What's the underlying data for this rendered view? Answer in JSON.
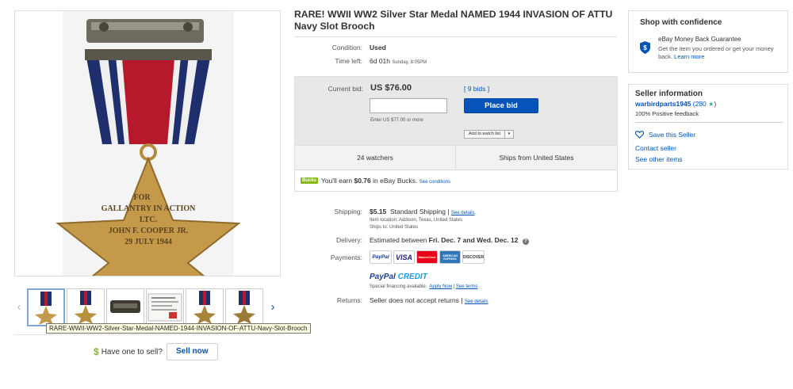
{
  "gallery": {
    "tooltip": "RARE-WWII-WW2-Silver-Star-Medal-NAMED-1944-INVASION-OF-ATTU-Navy-Slot-Brooch",
    "prev_arrow": "‹",
    "next_arrow": "›",
    "medal_text": {
      "line1": "FOR",
      "line2": "GALLANTRY IN ACTION",
      "line3": "LTC.",
      "line4": "JOHN F. COOPER JR.",
      "line5": "29 JULY 1944"
    }
  },
  "sell": {
    "icon": "$",
    "question": "Have one to sell?",
    "button": "Sell now"
  },
  "item": {
    "title": "RARE! WWII WW2 Silver Star Medal NAMED 1944 INVASION OF ATTU Navy Slot Brooch",
    "condition_label": "Condition:",
    "condition_value": "Used",
    "time_left_label": "Time left:",
    "time_left_value": "6d 01h",
    "time_left_detail": "Sunday, 8:05PM"
  },
  "bid": {
    "label": "Current bid:",
    "price": "US $76.00",
    "bids_link": "[ 9 bids ]",
    "input_placeholder": "",
    "hint": "Enter US $77.00 or more",
    "place_bid": "Place bid",
    "watch": "Add to watch list",
    "watch_dropdown": "▾",
    "watchers": "24 watchers",
    "ships_from": "Ships from United States"
  },
  "bucks": {
    "logo": "Bucks",
    "text_pre": "You'll earn ",
    "amount": "$0.76",
    "text_post": " in eBay Bucks.",
    "conditions": "See conditions"
  },
  "shipping": {
    "label": "Shipping:",
    "price": "$5.15",
    "method": "Standard Shipping |",
    "details": "See details",
    "location_line": "Item location:  Addison, Texas, United States",
    "ships_to": "Ships to:  United States"
  },
  "delivery": {
    "label": "Delivery:",
    "prefix": "Estimated between ",
    "range": "Fri. Dec. 7 and Wed. Dec. 12",
    "help_icon": "?"
  },
  "payments": {
    "label": "Payments:",
    "logos": [
      "PayPal",
      "VISA",
      "MasterCard",
      "AMERICAN EXPRESS",
      "DISCOVER"
    ],
    "paypal_credit_a": "PayPal",
    "paypal_credit_b": " CREDIT",
    "financing": "Special financing available.",
    "apply_now": "Apply Now",
    "separator": "|",
    "see_terms": "See terms"
  },
  "returns": {
    "label": "Returns:",
    "value": "Seller does not accept returns |",
    "details": "See details"
  },
  "confidence": {
    "title": "Shop with confidence",
    "heading": "eBay Money Back Guarantee",
    "desc": "Get the item you ordered or get your money back.",
    "learn_more": "Learn more"
  },
  "seller": {
    "title": "Seller information",
    "name": "warbirdparts1945",
    "score": " (280",
    "star": "★",
    "close": ")",
    "feedback": "100% Positive feedback",
    "save": "Save this Seller",
    "contact": "Contact seller",
    "other": "See other items"
  },
  "colors": {
    "link": "#0654ba",
    "bucks_green": "#86b817",
    "ribbon_blue": "#1f2f6e",
    "ribbon_red": "#b5192b",
    "medal_gold": "#c49a4a"
  }
}
